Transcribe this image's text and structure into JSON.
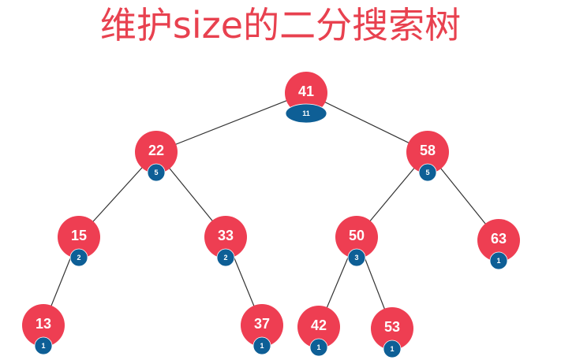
{
  "title": "维护size的二分搜索树",
  "colors": {
    "title": "#e8414f",
    "node": "#ee3e52",
    "badge": "#0e5f96",
    "edge": "#333333"
  },
  "tree": {
    "nodes": [
      {
        "id": "n41",
        "value": "41",
        "size": "11"
      },
      {
        "id": "n22",
        "value": "22",
        "size": "5"
      },
      {
        "id": "n58",
        "value": "58",
        "size": "5"
      },
      {
        "id": "n15",
        "value": "15",
        "size": "2"
      },
      {
        "id": "n33",
        "value": "33",
        "size": "2"
      },
      {
        "id": "n50",
        "value": "50",
        "size": "3"
      },
      {
        "id": "n63",
        "value": "63",
        "size": "1"
      },
      {
        "id": "n13",
        "value": "13",
        "size": "1"
      },
      {
        "id": "n37",
        "value": "37",
        "size": "1"
      },
      {
        "id": "n42",
        "value": "42",
        "size": "1"
      },
      {
        "id": "n53",
        "value": "53",
        "size": "1"
      }
    ],
    "edges": [
      [
        "n41",
        "n22"
      ],
      [
        "n41",
        "n58"
      ],
      [
        "n22",
        "n15"
      ],
      [
        "n22",
        "n33"
      ],
      [
        "n58",
        "n50"
      ],
      [
        "n58",
        "n63"
      ],
      [
        "n15",
        "n13"
      ],
      [
        "n33",
        "n37"
      ],
      [
        "n50",
        "n42"
      ],
      [
        "n50",
        "n53"
      ]
    ]
  }
}
